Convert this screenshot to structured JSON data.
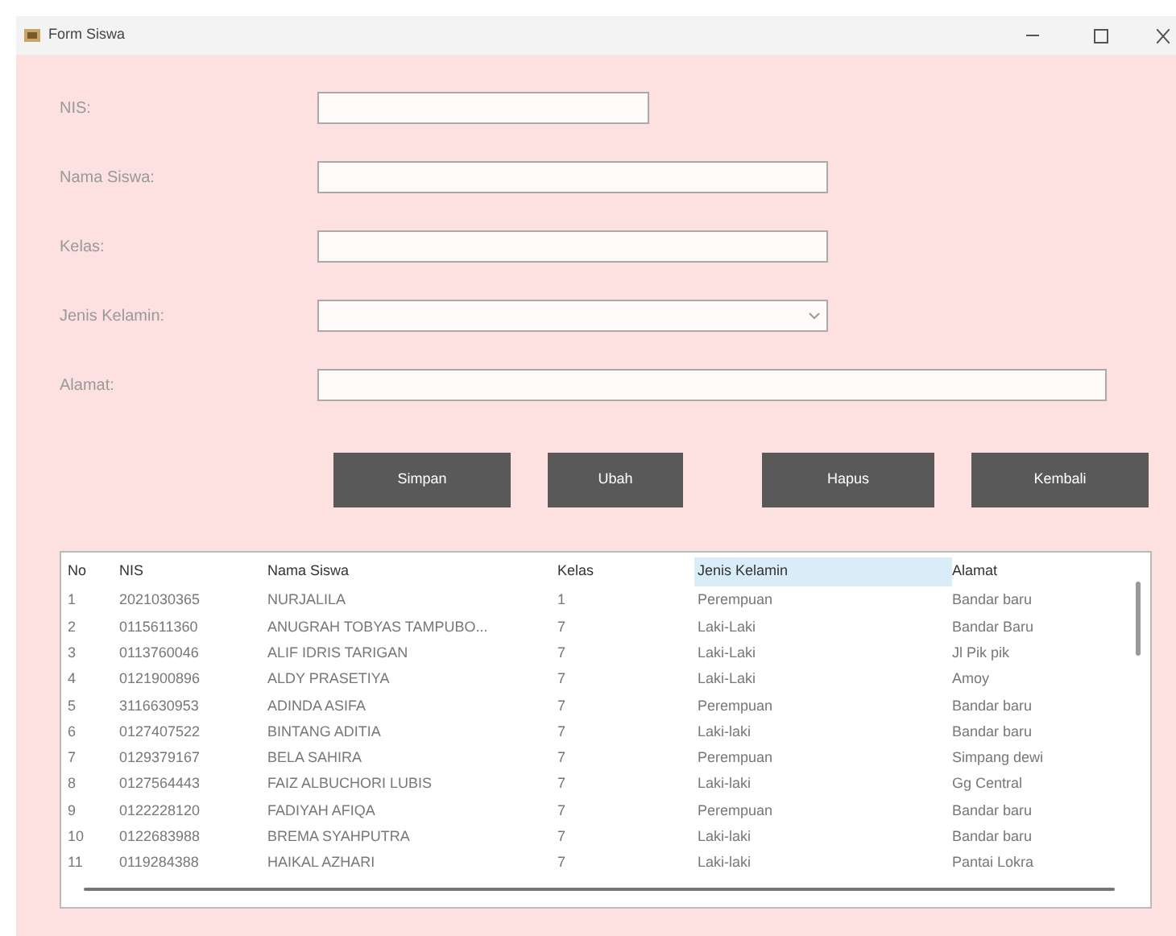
{
  "window": {
    "title": "Form Siswa"
  },
  "form": {
    "fields": [
      {
        "label": "NIS:",
        "kind": "text"
      },
      {
        "label": "Nama Siswa:",
        "kind": "text"
      },
      {
        "label": "Kelas:",
        "kind": "text"
      },
      {
        "label": "Jenis Kelamin:",
        "kind": "combo"
      },
      {
        "label": "Alamat:",
        "kind": "text"
      }
    ]
  },
  "buttons": [
    "Simpan",
    "Ubah",
    "Hapus",
    "Kembali"
  ],
  "table": {
    "columns": [
      {
        "label": "No",
        "selected": false
      },
      {
        "label": "NIS",
        "selected": false
      },
      {
        "label": "Nama Siswa",
        "selected": false
      },
      {
        "label": "Kelas",
        "selected": false
      },
      {
        "label": "Jenis Kelamin",
        "selected": true
      },
      {
        "label": "Alamat",
        "selected": false
      }
    ],
    "rows": [
      [
        "1",
        "2021030365",
        "NURJALILA",
        "1",
        "Perempuan",
        "Bandar baru"
      ],
      [
        "2",
        "0115611360",
        "ANUGRAH TOBYAS TAMPUBO...",
        "7",
        "Laki-Laki",
        "Bandar Baru"
      ],
      [
        "3",
        "0113760046",
        "ALIF IDRIS TARIGAN",
        "7",
        "Laki-Laki",
        "Jl Pik pik"
      ],
      [
        "4",
        "0121900896",
        "ALDY PRASETIYA",
        "7",
        "Laki-Laki",
        "Amoy"
      ],
      [
        "5",
        "3116630953",
        "ADINDA ASIFA",
        "7",
        "Perempuan",
        "Bandar baru"
      ],
      [
        "6",
        "0127407522",
        "BINTANG ADITIA",
        "7",
        "Laki-laki",
        "Bandar baru"
      ],
      [
        "7",
        "0129379167",
        "BELA SAHIRA",
        "7",
        "Perempuan",
        "Simpang dewi"
      ],
      [
        "8",
        "0127564443",
        "FAIZ ALBUCHORI LUBIS",
        "7",
        "Laki-laki",
        "Gg Central"
      ],
      [
        "9",
        "0122228120",
        "FADIYAH AFIQA",
        "7",
        "Perempuan",
        "Bandar baru"
      ],
      [
        "10",
        "0122683988",
        "BREMA SYAHPUTRA",
        "7",
        "Laki-laki",
        "Bandar baru"
      ],
      [
        "11",
        "0119284388",
        "HAIKAL AZHARI",
        "7",
        "Laki-laki",
        "Pantai Lokra"
      ]
    ]
  }
}
